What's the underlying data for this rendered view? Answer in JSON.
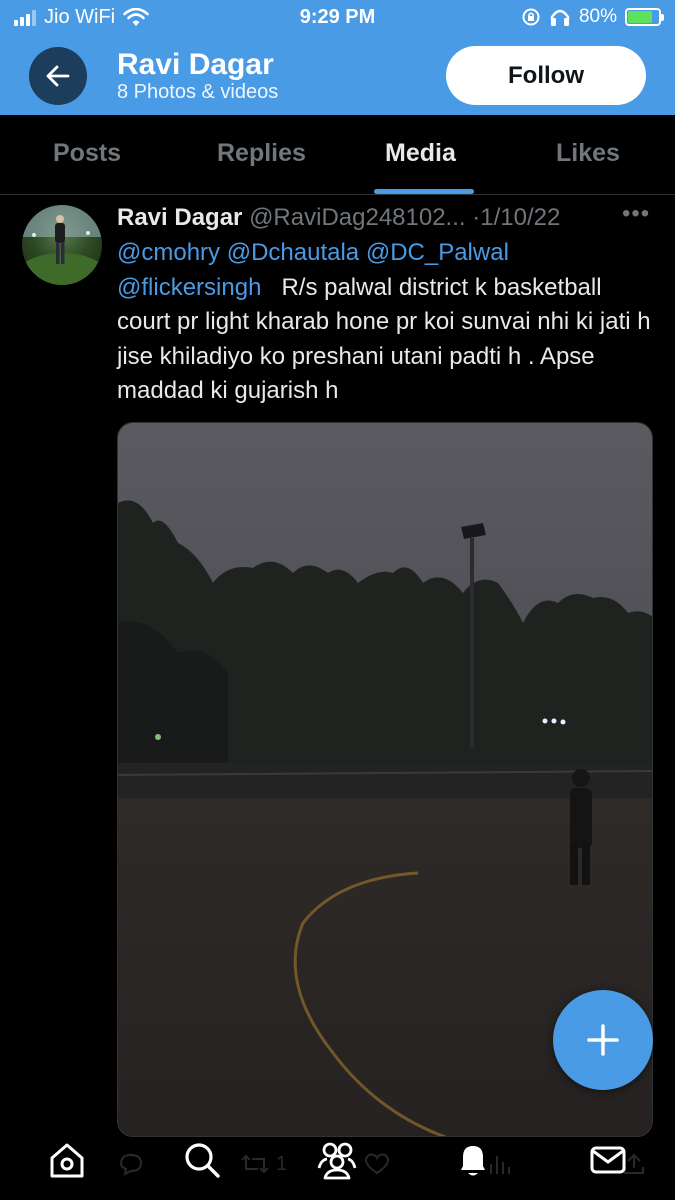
{
  "status_bar": {
    "carrier": "Jio WiFi",
    "time": "9:29 PM",
    "battery": "80%"
  },
  "header": {
    "name": "Ravi Dagar",
    "subtitle": "8 Photos & videos",
    "follow_label": "Follow"
  },
  "tabs": [
    {
      "label": "Posts",
      "active": false
    },
    {
      "label": "Replies",
      "active": false
    },
    {
      "label": "Media",
      "active": true
    },
    {
      "label": "Likes",
      "active": false
    }
  ],
  "tweet": {
    "name": "Ravi Dagar",
    "handle": "@RaviDag248102...",
    "dot": "·",
    "date": "1/10/22",
    "mentions": [
      "@cmohry",
      "@Dchautala",
      "@DC_Palwal",
      "@flickersingh"
    ],
    "body": "R/s palwal district k basketball court pr light kharab hone pr koi sunvai nhi ki jati h jise khiladiyo ko preshani utani padti h . Apse maddad ki gujarish h",
    "retweet_count": "1"
  },
  "icons": {
    "back": "arrow-left-icon",
    "more": "more-dots-icon",
    "fab": "plus-icon",
    "nav": [
      "home-icon",
      "search-icon",
      "communities-icon",
      "bell-icon",
      "mail-icon"
    ]
  },
  "colors": {
    "accent": "#4a9be6",
    "background": "#000000",
    "muted_text": "#71767b"
  }
}
